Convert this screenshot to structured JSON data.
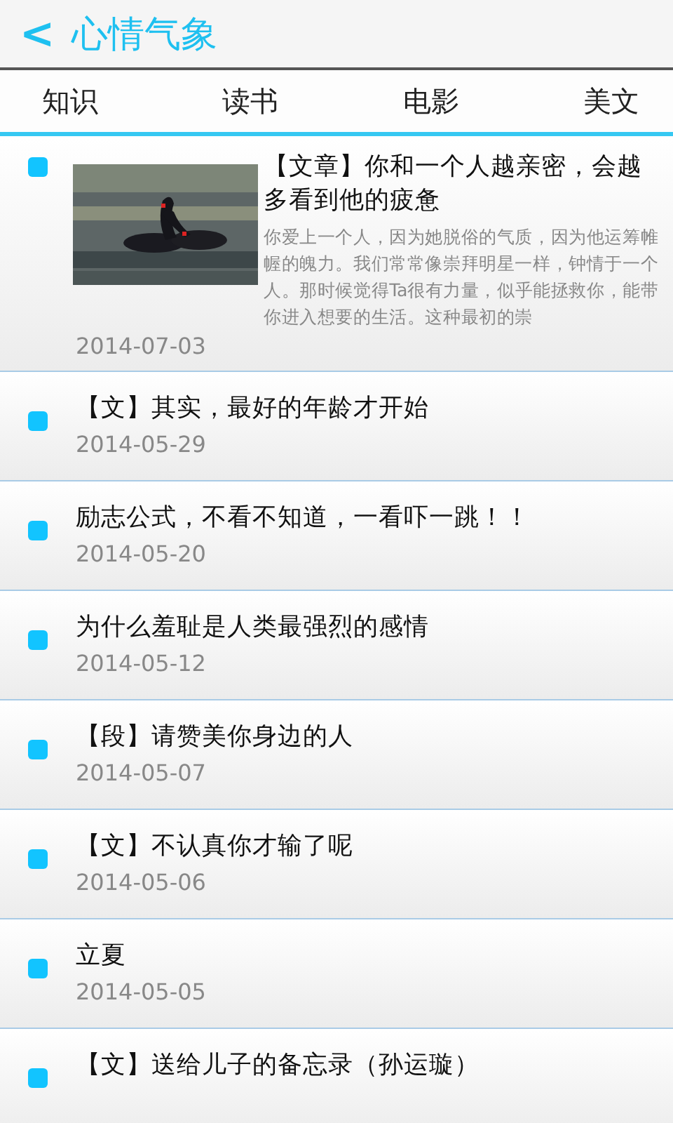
{
  "header": {
    "back_icon": "<",
    "title": "心情气象"
  },
  "tabs": [
    {
      "label": "知识"
    },
    {
      "label": "读书"
    },
    {
      "label": "电影"
    },
    {
      "label": "美文"
    }
  ],
  "articles": [
    {
      "title": "【文章】你和一个人越亲密，会越多看到他的疲惫",
      "summary": "你爱上一个人，因为她脱俗的气质，因为他运筹帷幄的魄力。我们常常像崇拜明星一样，钟情于一个人。那时候觉得Ta很有力量，似乎能拯救你，能带你进入想要的生活。这种最初的崇",
      "date": "2014-07-03"
    },
    {
      "title": "【文】其实，最好的年龄才开始",
      "date": "2014-05-29"
    },
    {
      "title": "励志公式，不看不知道，一看吓一跳！！",
      "date": "2014-05-20"
    },
    {
      "title": "为什么羞耻是人类最强烈的感情",
      "date": "2014-05-12"
    },
    {
      "title": "【段】请赞美你身边的人",
      "date": "2014-05-07"
    },
    {
      "title": "【文】不认真你才输了呢",
      "date": "2014-05-06"
    },
    {
      "title": "立夏",
      "date": "2014-05-05"
    },
    {
      "title": "【文】送给儿子的备忘录（孙运璇）"
    }
  ]
}
